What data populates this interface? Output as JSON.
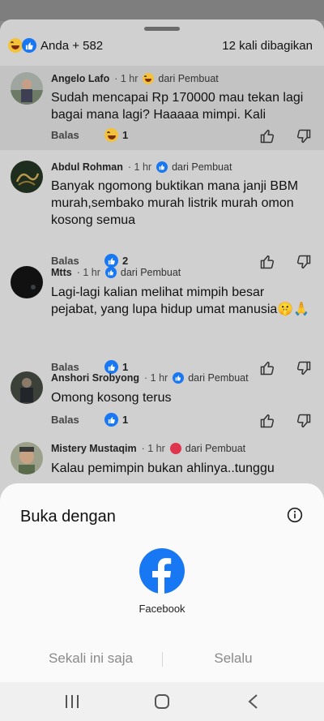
{
  "reactions_bar": {
    "reaction_icons": [
      "haha-icon",
      "like-icon"
    ],
    "summary": "Anda + 582",
    "shares": "12 kali dibagikan"
  },
  "comments": [
    {
      "name": "Angelo Lafo",
      "time": "1 hr",
      "badge_icon": "haha-icon",
      "badge_text": "dari Pembuat",
      "text": "Sudah mencapai Rp 170000 mau tekan lagi bagai mana lagi? Haaaaa mimpi. Kali",
      "reply_label": "Balas",
      "reaction_icon": "haha-icon",
      "reaction_count": "1"
    },
    {
      "name": "Abdul Rohman",
      "time": "1 hr",
      "badge_icon": "like-icon",
      "badge_text": "dari Pembuat",
      "text": "Banyak ngomong buktikan mana janji BBM murah,sembako murah listrik murah omon kosong semua",
      "reply_label": "Balas",
      "reaction_icon": "like-icon",
      "reaction_count": "2"
    },
    {
      "name": "Mtts",
      "time": "1 hr",
      "badge_icon": "like-icon",
      "badge_text": "dari Pembuat",
      "text": "Lagi-lagi kalian melihat mimpih besar pejabat, yang lupa hidup umat manusia🤫🙏",
      "reply_label": "Balas",
      "reaction_icon": "like-icon",
      "reaction_count": "1"
    },
    {
      "name": "Anshori Srobyong",
      "time": "1 hr",
      "badge_icon": "like-icon",
      "badge_text": "dari Pembuat",
      "text": "Omong kosong terus",
      "reply_label": "Balas",
      "reaction_icon": "like-icon",
      "reaction_count": "1"
    },
    {
      "name": "Mistery Mustaqim",
      "time": "1 hr",
      "badge_icon": "love-icon",
      "badge_text": "dari Pembuat",
      "text": "Kalau pemimpin bukan ahlinya..tunggu"
    }
  ],
  "open_with_dialog": {
    "title": "Buka dengan",
    "app_label": "Facebook",
    "once_label": "Sekali ini saja",
    "always_label": "Selalu"
  },
  "nav_bar": {
    "buttons": [
      "recent-apps-icon",
      "home-icon",
      "back-icon"
    ]
  },
  "colors": {
    "facebook_blue": "#1877f2",
    "love_red": "#e0354f",
    "haha_yellow": "#f4c23a"
  }
}
